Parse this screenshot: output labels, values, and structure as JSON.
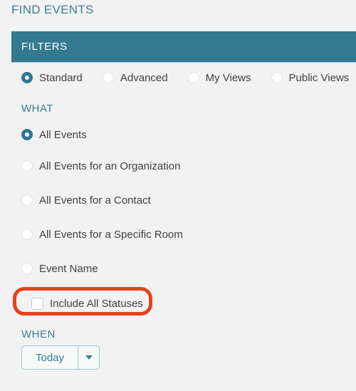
{
  "page": {
    "title": "FIND EVENTS",
    "background_color": "#f2f2f2"
  },
  "filter_panel": {
    "header_label": "FILTERS",
    "header_color": "#337a90",
    "view_types": {
      "selected": "Standard",
      "options": [
        {
          "label": "Standard",
          "selected": true
        },
        {
          "label": "Advanced",
          "selected": false
        },
        {
          "label": "My Views",
          "selected": false
        },
        {
          "label": "Public Views",
          "selected": false
        }
      ]
    },
    "what_section": {
      "heading": "WHAT",
      "selected": "All Events",
      "options": [
        {
          "label": "All Events",
          "selected": true
        },
        {
          "label": "All Events for an Organization",
          "selected": false
        },
        {
          "label": "All Events for a Contact",
          "selected": false
        },
        {
          "label": "All Events for a Specific Room",
          "selected": false
        },
        {
          "label": "Event Name",
          "selected": false
        }
      ],
      "include_all_statuses": {
        "label": "Include All Statuses",
        "checked": false,
        "highlighted": true,
        "highlight_color": "#e8411a"
      }
    },
    "when_section": {
      "heading": "WHEN",
      "date_range": {
        "value": "Today",
        "caret_icon": "chevron-down-icon"
      }
    }
  }
}
